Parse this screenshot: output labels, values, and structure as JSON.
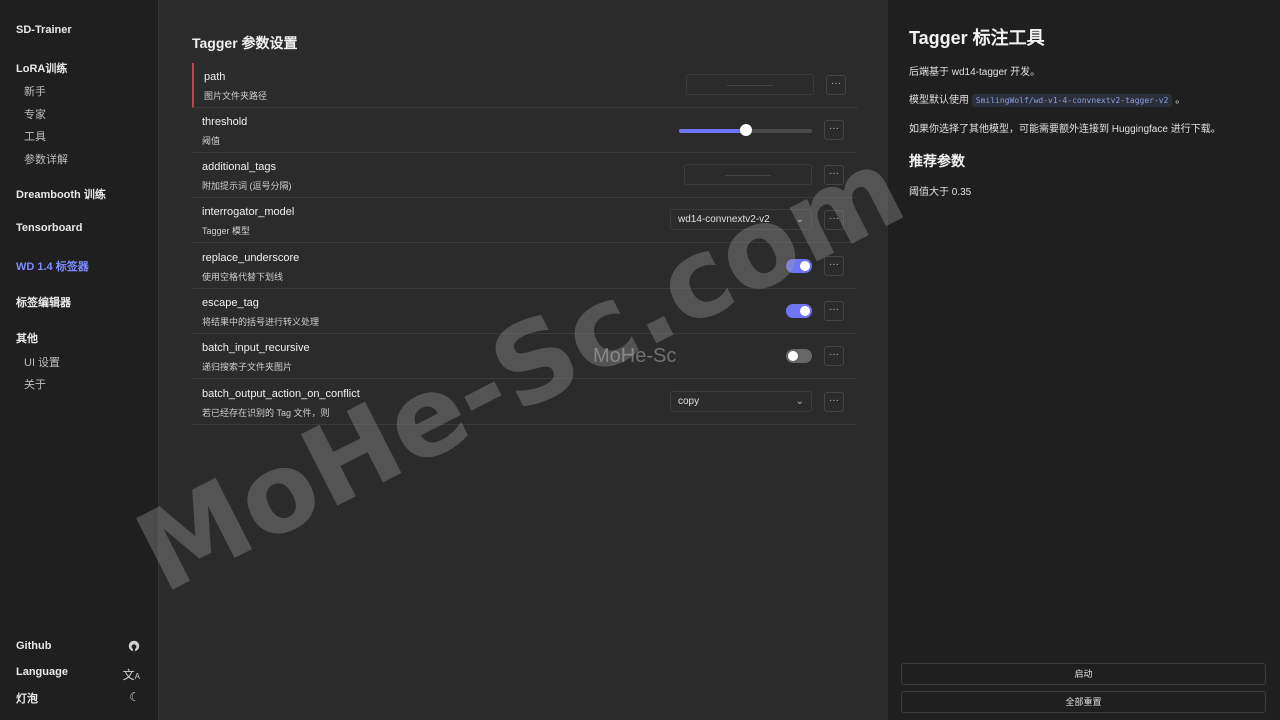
{
  "sidebar": {
    "app_title": "SD-Trainer",
    "lora": {
      "label": "LoRA训练",
      "items": [
        "新手",
        "专家",
        "工具",
        "参数详解"
      ]
    },
    "dreambooth": "Dreambooth 训练",
    "tensorboard": "Tensorboard",
    "wd_tagger": "WD 1.4 标签器",
    "tag_editor": "标签编辑器",
    "other": {
      "label": "其他",
      "items": [
        "UI 设置",
        "关于"
      ]
    },
    "github": "Github",
    "language": "Language",
    "lightbulb": "灯泡",
    "active_color": "#7b8cff"
  },
  "main": {
    "title": "Tagger 参数设置",
    "rows": [
      {
        "key": "path",
        "desc": "图片文件夹路径",
        "control": "text",
        "value": ""
      },
      {
        "key": "threshold",
        "desc": "阈值",
        "control": "slider",
        "value": 0.5
      },
      {
        "key": "additional_tags",
        "desc": "附加提示词 (逗号分隔)",
        "control": "text",
        "value": ""
      },
      {
        "key": "interrogator_model",
        "desc": "Tagger 模型",
        "control": "select",
        "value": "wd14-convnextv2-v2"
      },
      {
        "key": "replace_underscore",
        "desc": "使用空格代替下划线",
        "control": "toggle",
        "value": true
      },
      {
        "key": "escape_tag",
        "desc": "将结果中的括号进行转义处理",
        "control": "toggle",
        "value": true
      },
      {
        "key": "batch_input_recursive",
        "desc": "递归搜索子文件夹图片",
        "control": "toggle",
        "value": false
      },
      {
        "key": "batch_output_action_on_conflict",
        "desc": "若已经存在识别的 Tag 文件，则",
        "control": "select",
        "value": "copy"
      }
    ],
    "more_label": "···",
    "chevron": "⌄",
    "accent": "#7075f5"
  },
  "right": {
    "title": "Tagger 标注工具",
    "p1": "后端基于 wd14-tagger 开发。",
    "p2_pre": "模型默认使用",
    "p2_code": "SmilingWolf/wd-v1-4-convnextv2-tagger-v2",
    "p2_post": "。",
    "p3": "如果你选择了其他模型，可能需要额外连接到 Huggingface 进行下载。",
    "h2": "推荐参数",
    "p4": "阈值大于 0.35",
    "start_button": "启动",
    "reset_button": "全部重置"
  },
  "watermark": {
    "big": "MoHe-Sc.com",
    "small": "MoHe-Sc"
  }
}
